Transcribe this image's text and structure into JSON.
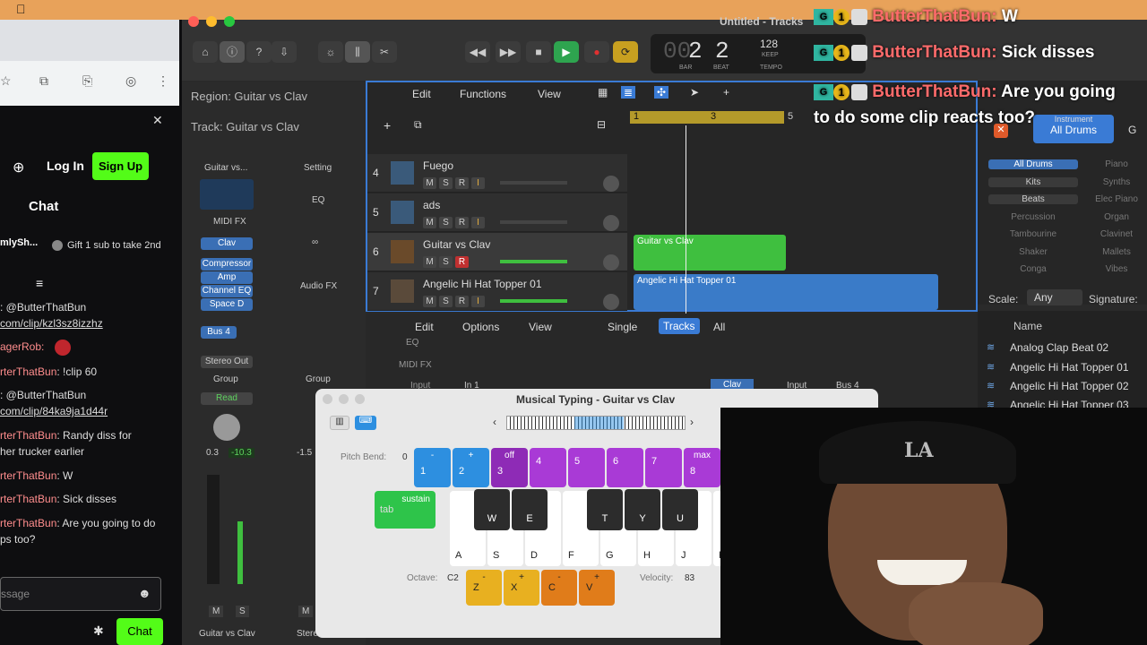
{
  "browser": {
    "login": "Log In",
    "signup": "Sign Up",
    "chat_title": "Chat",
    "pinned_user": "mlySh...",
    "gift_text": "Gift 1 sub to take 2nd",
    "messages": [
      {
        "user": "",
        "text": ": @ButterThatBun",
        "link": "com/clip/kzl3sz8izzhz"
      },
      {
        "user": "agerRob:",
        "text": ""
      },
      {
        "user": "rterThatBun",
        "text": ": !clip 60"
      },
      {
        "user": "",
        "text": ": @ButterThatBun",
        "link": "com/clip/84ka9ja1d44r"
      },
      {
        "user": "rterThatBun",
        "text": ": Randy diss for",
        "text2": "her trucker earlier"
      },
      {
        "user": "rterThatBun",
        "text": ": W"
      },
      {
        "user": "rterThatBun",
        "text": ": Sick disses"
      },
      {
        "user": "rterThatBun",
        "text": ": Are you going to do",
        "text2": "ps too?"
      }
    ],
    "chat_placeholder": "ssage",
    "chat_button": "Chat"
  },
  "logic": {
    "window_title": "Untitled - Tracks",
    "lcd": {
      "bar": "2",
      "beat": "2",
      "tempo": "128",
      "keep": "KEEP",
      "bar_label": "BAR",
      "beat_label": "BEAT",
      "tempo_label": "TEMPO",
      "ghost": "00"
    },
    "inspector": {
      "region": "Region: Guitar vs Clav",
      "track": "Track: Guitar vs Clav",
      "channel_name": "Guitar vs...",
      "setting": "Setting",
      "midi_fx": "MIDI FX",
      "eq": "EQ",
      "instrument": "Clav",
      "plugins": [
        "Compressor",
        "Amp",
        "Channel EQ",
        "Space D"
      ],
      "audio_fx": "Audio FX",
      "bus": "Bus 4",
      "output": "Stereo Out",
      "group": "Group",
      "group2": "Group",
      "automation": "Read",
      "pan": "0.3",
      "level": "-10.3",
      "level2": "-1.5",
      "m": "M",
      "s": "S",
      "m2": "M",
      "strip_name": "Guitar vs Clav",
      "strip_name2": "Stereo Out"
    },
    "tracks_menu": {
      "edit": "Edit",
      "functions": "Functions",
      "view": "View"
    },
    "ruler": [
      "1",
      "3",
      "5"
    ],
    "tracks": [
      {
        "num": "4",
        "name": "Fuego",
        "m": "M",
        "s": "S",
        "r": "R",
        "i": "I"
      },
      {
        "num": "5",
        "name": "ads",
        "m": "M",
        "s": "S",
        "r": "R",
        "i": "I"
      },
      {
        "num": "6",
        "name": "Guitar vs Clav",
        "m": "M",
        "s": "S",
        "r": "R",
        "i": "I"
      },
      {
        "num": "7",
        "name": "Angelic Hi Hat Topper 01",
        "m": "M",
        "s": "S",
        "r": "R",
        "i": "I"
      }
    ],
    "regions": {
      "green": "Guitar vs Clav",
      "blue": "Angelic Hi Hat Topper 01"
    },
    "mixer_menu": {
      "edit": "Edit",
      "options": "Options",
      "view": "View",
      "single": "Single",
      "tracks": "Tracks",
      "all": "All"
    },
    "mixer_rows": {
      "eq": "EQ",
      "midi_fx": "MIDI FX",
      "input": "Input",
      "in1": "In 1",
      "clav": "Clav",
      "input2": "Input",
      "bus4": "Bus 4"
    },
    "library": {
      "category": "Instrument",
      "selected": "All Drums",
      "g": "G",
      "left": [
        "All Drums",
        "Kits",
        "Beats",
        "Percussion",
        "Tambourine",
        "Shaker",
        "Conga"
      ],
      "right": [
        "Piano",
        "Synths",
        "Elec Piano",
        "Organ",
        "Clavinet",
        "Mallets",
        "Vibes"
      ],
      "scale_label": "Scale:",
      "scale_value": "Any",
      "signature_label": "Signature:",
      "name_header": "Name",
      "loops": [
        "Analog Clap Beat 02",
        "Angelic Hi Hat Topper 01",
        "Angelic Hi Hat Topper 02",
        "Angelic Hi Hat Topper 03"
      ]
    }
  },
  "musical_typing": {
    "title": "Musical Typing - Guitar vs Clav",
    "pitch_bend_label": "Pitch Bend:",
    "pitch_bend_value": "0",
    "pitch_keys": [
      {
        "top": "-",
        "num": "1",
        "color": "#2d8fe0"
      },
      {
        "top": "+",
        "num": "2",
        "color": "#2d8fe0"
      },
      {
        "top": "off",
        "num": "3",
        "color": "#8e2bb6"
      },
      {
        "top": "",
        "num": "4",
        "color": "#a93ad6"
      },
      {
        "top": "",
        "num": "5",
        "color": "#a93ad6"
      },
      {
        "top": "",
        "num": "6",
        "color": "#a93ad6"
      },
      {
        "top": "",
        "num": "7",
        "color": "#a93ad6"
      },
      {
        "top": "max",
        "num": "8",
        "color": "#a93ad6"
      }
    ],
    "sustain_label": "sustain",
    "sustain_key": "tab",
    "black_keys": [
      "W",
      "E",
      "T",
      "Y",
      "U"
    ],
    "white_keys": [
      "A",
      "S",
      "D",
      "F",
      "G",
      "H",
      "J",
      "K"
    ],
    "octave_label": "Octave:",
    "octave_value": "C2",
    "octave_keys": [
      {
        "top": "-",
        "key": "Z",
        "color": "#e8b020"
      },
      {
        "top": "+",
        "key": "X",
        "color": "#e8b020"
      },
      {
        "top": "-",
        "key": "C",
        "color": "#e07c1a"
      },
      {
        "top": "+",
        "key": "V",
        "color": "#e07c1a"
      }
    ],
    "velocity_label": "Velocity:",
    "velocity_value": "83"
  },
  "overlay_chat": [
    {
      "name": "ButterThatBun:",
      "text": "W"
    },
    {
      "name": "ButterThatBun:",
      "text": "Sick disses"
    },
    {
      "name": "ButterThatBun:",
      "text": "Are you going",
      "text2": "to do some clip reacts too?"
    }
  ],
  "cam": {
    "cap_text": "LA"
  }
}
